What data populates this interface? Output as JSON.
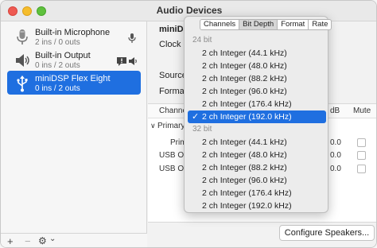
{
  "window": {
    "title": "Audio Devices"
  },
  "sidebar": {
    "devices": [
      {
        "name": "Built-in Microphone",
        "sub": "2 ins / 0 outs",
        "icon": "microphone-icon"
      },
      {
        "name": "Built-in Output",
        "sub": "0 ins / 2 outs",
        "icon": "speaker-icon"
      },
      {
        "name": "miniDSP Flex Eight",
        "sub": "0 ins / 2 outs",
        "icon": "usb-icon",
        "selected": true
      }
    ],
    "footer": {
      "add": "+",
      "remove": "−",
      "gear": "⚙",
      "chevron": "⌄"
    }
  },
  "main": {
    "device_title": "miniDSI",
    "clock_label": "Clock S",
    "source_label": "Source",
    "format_label": "Format",
    "table_headers": {
      "channel": "Channel",
      "db": "dB",
      "mute": "Mute"
    },
    "group": "Primary",
    "group_arrow": "∨",
    "rows": [
      {
        "label": "Prim",
        "value": "0.0"
      },
      {
        "label": "USB OU",
        "value": "0.0"
      },
      {
        "label": "USB OU",
        "value": "0.0"
      }
    ],
    "configure_button": "Configure Speakers..."
  },
  "popup": {
    "tabs": [
      "Channels",
      "Bit Depth",
      "Format",
      "Rate"
    ],
    "active_tab": "Bit Depth",
    "groups": [
      {
        "label": "24 bit",
        "items": [
          "2 ch Integer (44.1 kHz)",
          "2 ch Integer (48.0 kHz)",
          "2 ch Integer (88.2 kHz)",
          "2 ch Integer (96.0 kHz)",
          "2 ch Integer (176.4 kHz)",
          "2 ch Integer (192.0 kHz)"
        ]
      },
      {
        "label": "32 bit",
        "items": [
          "2 ch Integer (44.1 kHz)",
          "2 ch Integer (48.0 kHz)",
          "2 ch Integer (88.2 kHz)",
          "2 ch Integer (96.0 kHz)",
          "2 ch Integer (176.4 kHz)",
          "2 ch Integer (192.0 kHz)"
        ]
      }
    ],
    "selected_item": "24 bit / 2 ch Integer (192.0 kHz)",
    "check_mark": "✓"
  },
  "colors": {
    "accent": "#1f6fe0",
    "window_bg": "#f2f2f2"
  }
}
